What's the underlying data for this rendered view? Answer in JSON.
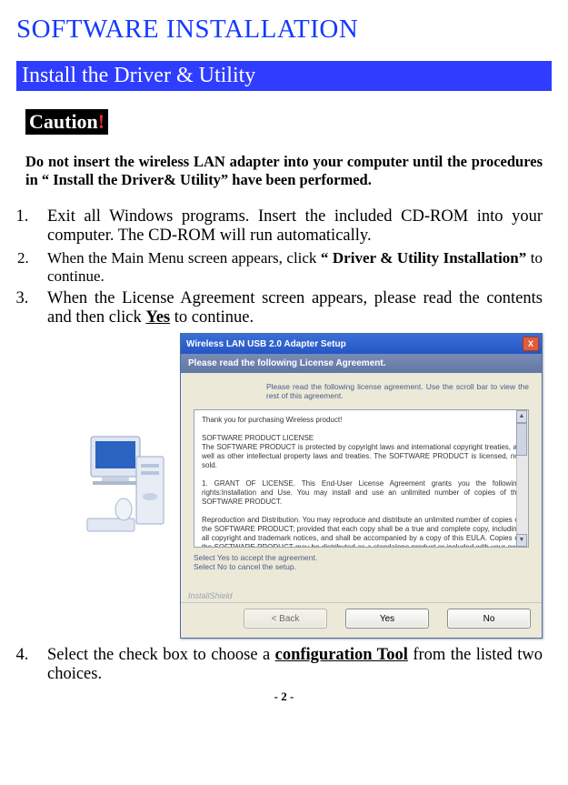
{
  "h1": "SOFTWARE INSTALLATION",
  "section": "Install the Driver & Utility",
  "caution_word": "Caution",
  "caution_bang": "!",
  "warning": "Do not insert the wireless LAN adapter into your computer until the procedures in “ Install the Driver& Utility” have been performed.",
  "steps": {
    "s1": "Exit all Windows programs. Insert the included CD-ROM into your computer. The CD-ROM will run automatically.",
    "s2_a": "When the Main Menu screen appears, click ",
    "s2_b": "“ Driver & Utility Installation”",
    "s2_c": " to continue.",
    "s3_a": "When the License Agreement screen appears, please read the contents and then click ",
    "s3_b": "Yes",
    "s3_c": " to continue.",
    "s4_a": "Select the check box to choose a ",
    "s4_b": "configuration Tool",
    "s4_c": " from the listed two choices."
  },
  "dialog": {
    "title": "Wireless LAN USB 2.0 Adapter Setup",
    "subtitle": "Please read the following License Agreement.",
    "intro": "Please read the following license agreement. Use the scroll bar to view the rest of this agreement.",
    "lic1": "Thank you for purchasing Wireless product!",
    "lic2": "SOFTWARE PRODUCT LICENSE",
    "lic3": "The SOFTWARE PRODUCT is protected by copyright laws and international copyright treaties, as well as other intellectual property laws and treaties. The SOFTWARE PRODUCT is licensed, not sold.",
    "lic4": "1. GRANT OF LICENSE. This End-User License Agreement grants you the following rights:Installation and Use. You may install and use an unlimited number of copies of the SOFTWARE PRODUCT.",
    "lic5": "Reproduction and Distribution. You may reproduce and distribute an unlimited number of copies of the SOFTWARE PRODUCT; provided that each copy shall be a true and complete copy, including all copyright and trademark notices, and shall be accompanied by a copy of this EULA. Copies of the SOFTWARE PRODUCT may be distributed as a standalone product or included with your own product.",
    "post1": "Select Yes to accept the agreement.",
    "post2": "Select No to cancel the setup.",
    "brand": "InstallShield",
    "btn_back": "< Back",
    "btn_yes": "Yes",
    "btn_no": "No",
    "close_x": "X"
  },
  "page_number": "- 2 -"
}
